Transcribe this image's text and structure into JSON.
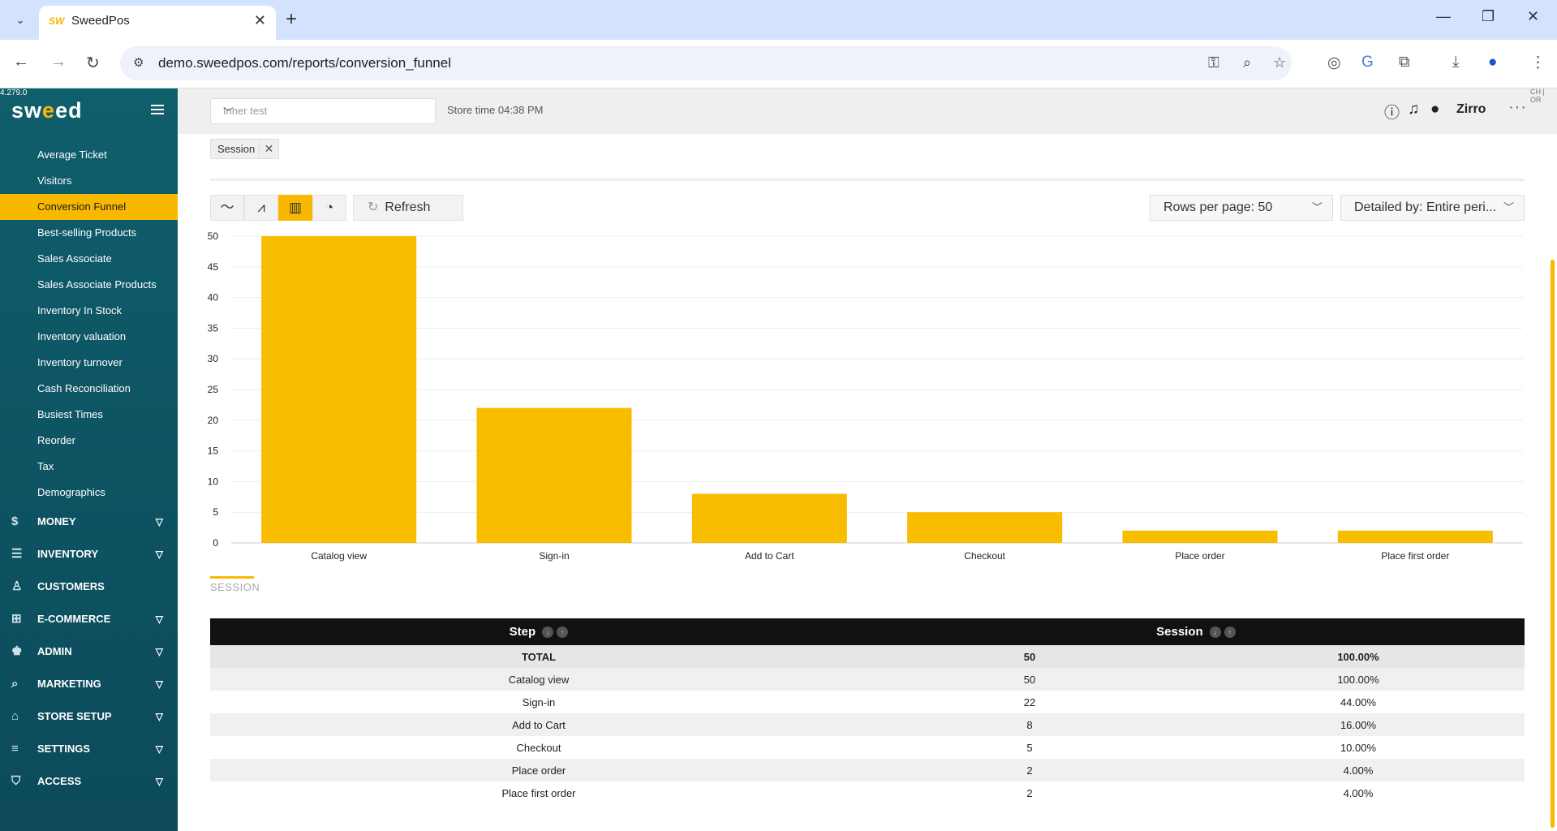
{
  "browser": {
    "tab_title": "SweedPos",
    "tab_favicon": "SW",
    "url": "demo.sweedpos.com/reports/conversion_funnel"
  },
  "sidebar": {
    "version": "4.279.0",
    "logo_left": "sw",
    "logo_mid": "e",
    "logo_right": "ed",
    "report_items": [
      {
        "label": "Average Ticket"
      },
      {
        "label": "Visitors"
      },
      {
        "label": "Conversion Funnel",
        "active": true
      },
      {
        "label": "Best-selling Products"
      },
      {
        "label": "Sales Associate"
      },
      {
        "label": "Sales Associate Products"
      },
      {
        "label": "Inventory In Stock"
      },
      {
        "label": "Inventory valuation"
      },
      {
        "label": "Inventory turnover"
      },
      {
        "label": "Cash Reconciliation"
      },
      {
        "label": "Busiest Times"
      },
      {
        "label": "Reorder"
      },
      {
        "label": "Tax"
      },
      {
        "label": "Demographics"
      }
    ],
    "sections": [
      {
        "label": "MONEY",
        "icon": "dollar-icon",
        "chevron": true
      },
      {
        "label": "INVENTORY",
        "icon": "list-icon",
        "chevron": true
      },
      {
        "label": "CUSTOMERS",
        "icon": "person-icon",
        "chevron": false
      },
      {
        "label": "E-COMMERCE",
        "icon": "basket-icon",
        "chevron": true
      },
      {
        "label": "ADMIN",
        "icon": "admin-icon",
        "chevron": true
      },
      {
        "label": "MARKETING",
        "icon": "search-icon",
        "chevron": true
      },
      {
        "label": "STORE SETUP",
        "icon": "home-icon",
        "chevron": true
      },
      {
        "label": "SETTINGS",
        "icon": "sliders-icon",
        "chevron": true
      },
      {
        "label": "ACCESS",
        "icon": "shield-icon",
        "chevron": true
      }
    ]
  },
  "topbar": {
    "store_placeholder": "Inner test",
    "store_time": "Store time 04:38 PM",
    "user_name": "Zirro",
    "corner_text": "CH | OR"
  },
  "filters": {
    "chip_label": "Session"
  },
  "toolbar": {
    "refresh_label": "Refresh",
    "rows_per_page": "Rows per page: 50",
    "detailed_by": "Detailed by: Entire peri..."
  },
  "chart_data": {
    "type": "bar",
    "categories": [
      "Catalog view",
      "Sign-in",
      "Add to Cart",
      "Checkout",
      "Place order",
      "Place first order"
    ],
    "values": [
      50,
      22,
      8,
      5,
      2,
      2
    ],
    "ylim": [
      0,
      50
    ],
    "yticks": [
      0,
      5,
      10,
      15,
      20,
      25,
      30,
      35,
      40,
      45,
      50
    ],
    "color": "#f9bd00",
    "grid": true
  },
  "session_tab": "SESSION",
  "table": {
    "headers": [
      "Step",
      "Session"
    ],
    "total": {
      "label": "TOTAL",
      "value": "50",
      "pct": "100.00%"
    },
    "rows": [
      {
        "step": "Catalog view",
        "value": "50",
        "pct": "100.00%"
      },
      {
        "step": "Sign-in",
        "value": "22",
        "pct": "44.00%"
      },
      {
        "step": "Add to Cart",
        "value": "8",
        "pct": "16.00%"
      },
      {
        "step": "Checkout",
        "value": "5",
        "pct": "10.00%"
      },
      {
        "step": "Place order",
        "value": "2",
        "pct": "4.00%"
      },
      {
        "step": "Place first order",
        "value": "2",
        "pct": "4.00%"
      }
    ]
  }
}
